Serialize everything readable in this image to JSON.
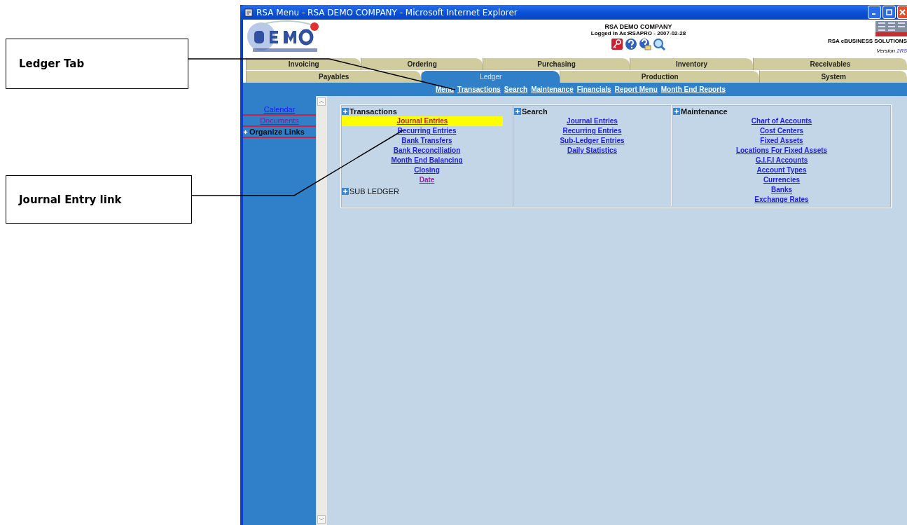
{
  "callouts": [
    {
      "text": "Ledger Tab"
    },
    {
      "text": "Journal Entry link"
    }
  ],
  "window": {
    "title": "RSA Menu - RSA DEMO COMPANY - Microsoft Internet Explorer"
  },
  "header": {
    "company": "RSA DEMO COMPANY",
    "logged_in": "Logged In As:RSAPRO - 2007-02-28",
    "vendor": "RSA eBUSINESS SOLUTIONS",
    "version_label": "Version",
    "version_number": "2R5"
  },
  "tab_rows": [
    [
      {
        "label": "Invoicing",
        "selected": false
      },
      {
        "label": "Ordering",
        "selected": false
      },
      {
        "label": "Purchasing",
        "selected": false
      },
      {
        "label": "Inventory",
        "selected": false
      },
      {
        "label": "Receivables",
        "selected": false
      }
    ],
    [
      {
        "label": "Payables",
        "selected": false
      },
      {
        "label": "Ledger",
        "selected": true
      },
      {
        "label": "Production",
        "selected": false
      },
      {
        "label": "System",
        "selected": false
      }
    ]
  ],
  "nav_links": [
    "Menu",
    "Transactions",
    "Search",
    "Maintenance",
    "Financials",
    "Report Menu",
    "Month End Reports"
  ],
  "sidebar": {
    "items": [
      {
        "kind": "link",
        "text": "Calendar",
        "visited": false
      },
      {
        "kind": "link",
        "text": "Documents",
        "visited": true
      },
      {
        "kind": "group",
        "text": "Organize Links"
      }
    ]
  },
  "columns": [
    {
      "items": [
        {
          "kind": "heading",
          "text": "Transactions"
        },
        {
          "kind": "link",
          "text": "Journal Entries",
          "visited": false,
          "highlighted": true
        },
        {
          "kind": "link",
          "text": "Recurring Entries",
          "visited": false,
          "highlighted": false
        },
        {
          "kind": "link",
          "text": "Bank Transfers",
          "visited": false,
          "highlighted": false
        },
        {
          "kind": "link",
          "text": "Bank Reconciliation",
          "visited": false,
          "highlighted": false
        },
        {
          "kind": "link",
          "text": "Month End Balancing",
          "visited": false,
          "highlighted": false
        },
        {
          "kind": "link",
          "text": "Closing",
          "visited": false,
          "highlighted": false
        },
        {
          "kind": "link",
          "text": "Date",
          "visited": true,
          "highlighted": false
        },
        {
          "kind": "heading",
          "text": "SUB LEDGER"
        }
      ]
    },
    {
      "items": [
        {
          "kind": "heading",
          "text": "Search"
        },
        {
          "kind": "link",
          "text": "Journal Entries",
          "visited": false,
          "highlighted": false
        },
        {
          "kind": "link",
          "text": "Recurring Entries",
          "visited": false,
          "highlighted": false
        },
        {
          "kind": "link",
          "text": "Sub-Ledger Entries",
          "visited": false,
          "highlighted": false
        },
        {
          "kind": "link",
          "text": "Daily Statistics",
          "visited": false,
          "highlighted": false
        }
      ]
    },
    {
      "items": [
        {
          "kind": "heading",
          "text": "Maintenance"
        },
        {
          "kind": "link",
          "text": "Chart of Accounts",
          "visited": false,
          "highlighted": false
        },
        {
          "kind": "link",
          "text": "Cost Centers",
          "visited": false,
          "highlighted": false
        },
        {
          "kind": "link",
          "text": "Fixed Assets",
          "visited": false,
          "highlighted": false
        },
        {
          "kind": "link",
          "text": "Locations For Fixed Assets",
          "visited": false,
          "highlighted": false
        },
        {
          "kind": "link",
          "text": "G.I.F.I Accounts",
          "visited": false,
          "highlighted": false
        },
        {
          "kind": "link",
          "text": "Account Types",
          "visited": false,
          "highlighted": false
        },
        {
          "kind": "link",
          "text": "Currencies",
          "visited": false,
          "highlighted": false
        },
        {
          "kind": "link",
          "text": "Banks",
          "visited": false,
          "highlighted": false
        },
        {
          "kind": "link",
          "text": "Exchange Rates",
          "visited": false,
          "highlighted": false
        }
      ]
    }
  ]
}
